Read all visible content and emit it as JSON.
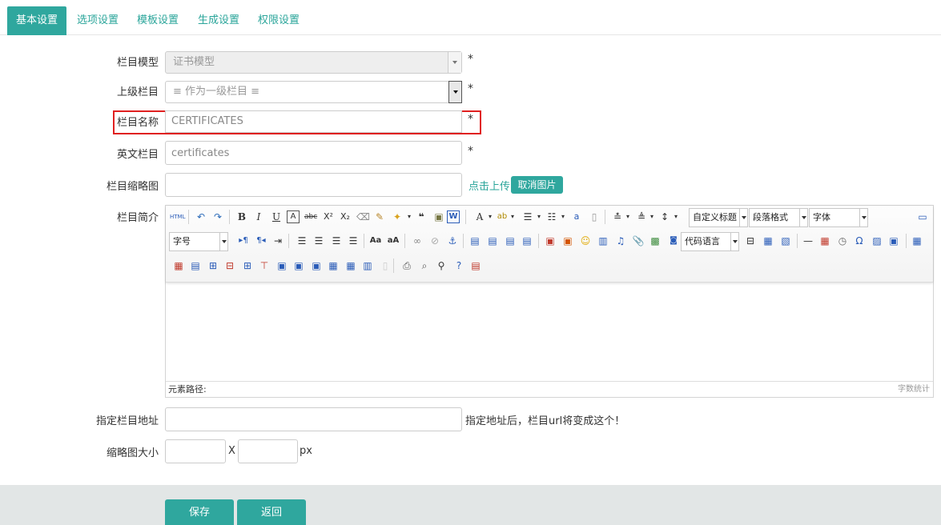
{
  "tabs": [
    {
      "label": "基本设置",
      "active": true
    },
    {
      "label": "选项设置"
    },
    {
      "label": "模板设置"
    },
    {
      "label": "生成设置"
    },
    {
      "label": "权限设置"
    }
  ],
  "form": {
    "model": {
      "label": "栏目模型",
      "value": "证书模型",
      "required": "*"
    },
    "parent": {
      "label": "上级栏目",
      "value": "≡ 作为一级栏目 ≡",
      "required": "*"
    },
    "name": {
      "label": "栏目名称",
      "value": "CERTIFICATES",
      "required": "*"
    },
    "english": {
      "label": "英文栏目",
      "value": "certificates",
      "required": "*"
    },
    "thumb": {
      "label": "栏目缩略图",
      "value": "",
      "upload_link": "点击上传",
      "cancel_button": "取消图片"
    },
    "intro": {
      "label": "栏目简介"
    },
    "url": {
      "label": "指定栏目地址",
      "value": "",
      "hint": "指定地址后，栏目url将变成这个！"
    },
    "thumb_size": {
      "label": "缩略图大小",
      "width": "",
      "height": "",
      "separator": "X",
      "unit": "px"
    }
  },
  "editor": {
    "combos": {
      "custom_title": "自定义标题",
      "paragraph": "段落格式",
      "font_family": "字体",
      "font_size": "字号",
      "code_lang": "代码语言"
    },
    "footer_path": "元素路径:",
    "footer_count": "字数统计"
  },
  "actions": {
    "save": "保存",
    "back": "返回"
  },
  "colors": {
    "accent": "#2fa79e",
    "highlight": "#e02020"
  }
}
